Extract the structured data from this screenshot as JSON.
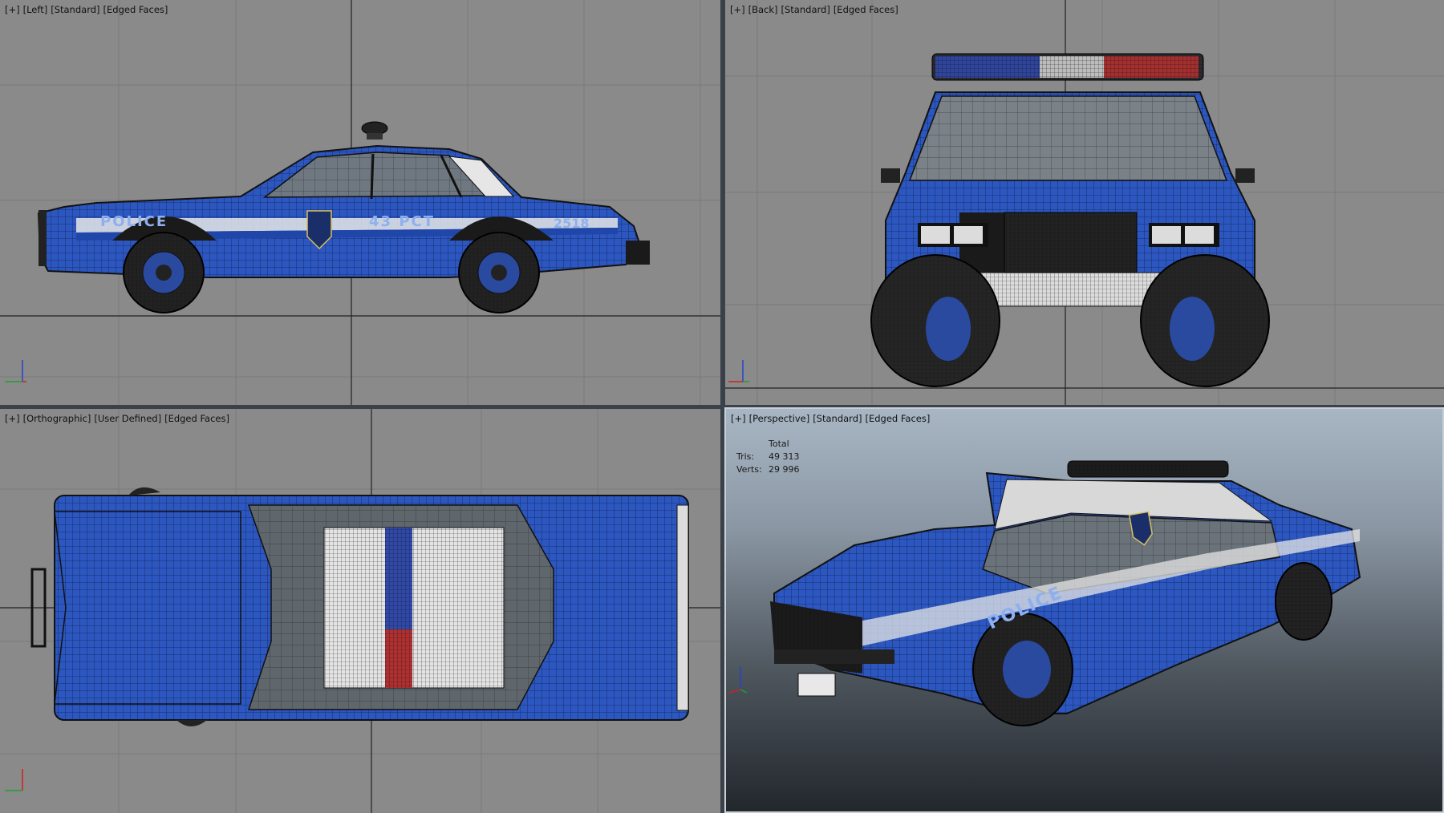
{
  "viewports": {
    "left": {
      "labels": [
        "[+]",
        "[Left]",
        "[Standard]",
        "[Edged Faces]"
      ]
    },
    "back": {
      "labels": [
        "[+]",
        "[Back]",
        "[Standard]",
        "[Edged Faces]"
      ]
    },
    "top": {
      "labels": [
        "[+]",
        "[Orthographic]",
        "[User Defined]",
        "[Edged Faces]"
      ]
    },
    "perspective": {
      "labels": [
        "[+]",
        "[Perspective]",
        "[Standard]",
        "[Edged Faces]"
      ],
      "stats": {
        "header": "Total",
        "tris_label": "Tris:",
        "tris_value": "49 313",
        "verts_label": "Verts:",
        "verts_value": "29 996"
      }
    }
  },
  "car_decals": {
    "side_text": "POLICE",
    "precinct": "43 PCT",
    "unit_number": "2518"
  },
  "axis_labels": {
    "x": "x",
    "y": "y",
    "z": "z"
  },
  "colors": {
    "body_blue": "#2c57c0",
    "grid_bg": "#8a8a8a",
    "stripe": "#e6e6e6",
    "wire": "#111111",
    "light_red": "#b03030",
    "light_blue": "#3048a8"
  }
}
